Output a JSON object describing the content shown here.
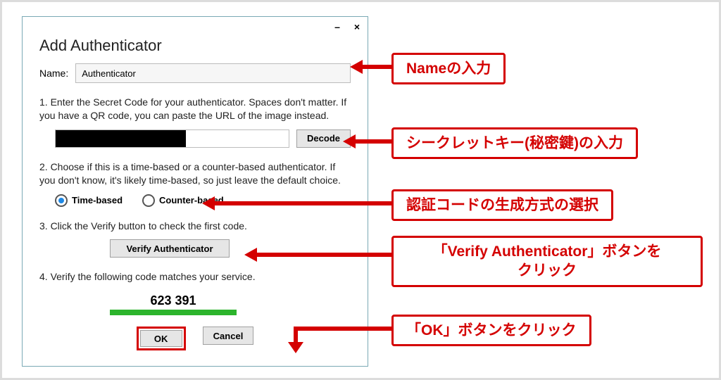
{
  "dialog": {
    "title": "Add Authenticator",
    "name_label": "Name:",
    "name_value": "Authenticator",
    "step1": "1. Enter the Secret Code for your authenticator. Spaces don't matter. If you have a QR code, you can paste the URL of the image instead.",
    "decode_btn": "Decode",
    "step2": "2. Choose if this is a time-based or a counter-based authenticator. If you don't know, it's likely time-based, so just leave the default choice.",
    "radio_time": "Time-based",
    "radio_counter": "Counter-based",
    "radio_selected": "time",
    "step3": "3. Click the Verify button to check the first code.",
    "verify_btn": "Verify Authenticator",
    "step4": "4. Verify the following code matches your service.",
    "code": "623 391",
    "ok_btn": "OK",
    "cancel_btn": "Cancel",
    "minimize": "–",
    "close": "×"
  },
  "callouts": {
    "c1": "Nameの入力",
    "c2": "シークレットキー(秘密鍵)の入力",
    "c3": "認証コードの生成方式の選択",
    "c4": "「Verify Authenticator」ボタンを\nクリック",
    "c5": "「OK」ボタンをクリック"
  }
}
